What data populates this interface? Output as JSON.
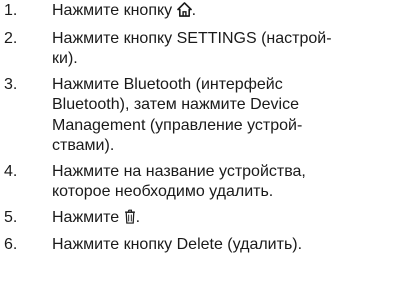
{
  "steps": [
    {
      "number": "1.",
      "text_before": "Нажмите кнопку ",
      "icon": "home-icon",
      "text_after": "."
    },
    {
      "number": "2.",
      "lines": [
        "Нажмите кнопку SETTINGS (настрой-",
        "ки)."
      ]
    },
    {
      "number": "3.",
      "lines": [
        "Нажмите Bluetooth (интерфейс",
        "Bluetooth), затем нажмите Device",
        "Management (управление устрой-",
        "ствами)."
      ]
    },
    {
      "number": "4.",
      "lines": [
        "Нажмите на название устройства,",
        "которое необходимо удалить."
      ]
    },
    {
      "number": "5.",
      "text_before": "Нажмите ",
      "icon": "trash-icon",
      "text_after": "."
    },
    {
      "number": "6.",
      "lines": [
        "Нажмите кнопку Delete (удалить)."
      ]
    }
  ]
}
